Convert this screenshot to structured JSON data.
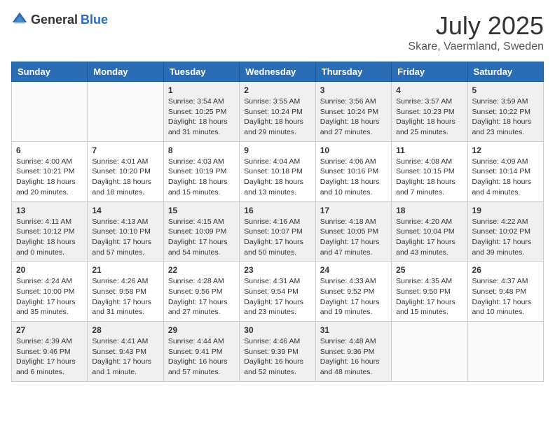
{
  "header": {
    "logo_general": "General",
    "logo_blue": "Blue",
    "month": "July 2025",
    "location": "Skare, Vaermland, Sweden"
  },
  "days_of_week": [
    "Sunday",
    "Monday",
    "Tuesday",
    "Wednesday",
    "Thursday",
    "Friday",
    "Saturday"
  ],
  "weeks": [
    [
      {
        "day": "",
        "empty": true
      },
      {
        "day": "",
        "empty": true
      },
      {
        "day": "1",
        "sunrise": "Sunrise: 3:54 AM",
        "sunset": "Sunset: 10:25 PM",
        "daylight": "Daylight: 18 hours and 31 minutes."
      },
      {
        "day": "2",
        "sunrise": "Sunrise: 3:55 AM",
        "sunset": "Sunset: 10:24 PM",
        "daylight": "Daylight: 18 hours and 29 minutes."
      },
      {
        "day": "3",
        "sunrise": "Sunrise: 3:56 AM",
        "sunset": "Sunset: 10:24 PM",
        "daylight": "Daylight: 18 hours and 27 minutes."
      },
      {
        "day": "4",
        "sunrise": "Sunrise: 3:57 AM",
        "sunset": "Sunset: 10:23 PM",
        "daylight": "Daylight: 18 hours and 25 minutes."
      },
      {
        "day": "5",
        "sunrise": "Sunrise: 3:59 AM",
        "sunset": "Sunset: 10:22 PM",
        "daylight": "Daylight: 18 hours and 23 minutes."
      }
    ],
    [
      {
        "day": "6",
        "sunrise": "Sunrise: 4:00 AM",
        "sunset": "Sunset: 10:21 PM",
        "daylight": "Daylight: 18 hours and 20 minutes."
      },
      {
        "day": "7",
        "sunrise": "Sunrise: 4:01 AM",
        "sunset": "Sunset: 10:20 PM",
        "daylight": "Daylight: 18 hours and 18 minutes."
      },
      {
        "day": "8",
        "sunrise": "Sunrise: 4:03 AM",
        "sunset": "Sunset: 10:19 PM",
        "daylight": "Daylight: 18 hours and 15 minutes."
      },
      {
        "day": "9",
        "sunrise": "Sunrise: 4:04 AM",
        "sunset": "Sunset: 10:18 PM",
        "daylight": "Daylight: 18 hours and 13 minutes."
      },
      {
        "day": "10",
        "sunrise": "Sunrise: 4:06 AM",
        "sunset": "Sunset: 10:16 PM",
        "daylight": "Daylight: 18 hours and 10 minutes."
      },
      {
        "day": "11",
        "sunrise": "Sunrise: 4:08 AM",
        "sunset": "Sunset: 10:15 PM",
        "daylight": "Daylight: 18 hours and 7 minutes."
      },
      {
        "day": "12",
        "sunrise": "Sunrise: 4:09 AM",
        "sunset": "Sunset: 10:14 PM",
        "daylight": "Daylight: 18 hours and 4 minutes."
      }
    ],
    [
      {
        "day": "13",
        "sunrise": "Sunrise: 4:11 AM",
        "sunset": "Sunset: 10:12 PM",
        "daylight": "Daylight: 18 hours and 0 minutes."
      },
      {
        "day": "14",
        "sunrise": "Sunrise: 4:13 AM",
        "sunset": "Sunset: 10:10 PM",
        "daylight": "Daylight: 17 hours and 57 minutes."
      },
      {
        "day": "15",
        "sunrise": "Sunrise: 4:15 AM",
        "sunset": "Sunset: 10:09 PM",
        "daylight": "Daylight: 17 hours and 54 minutes."
      },
      {
        "day": "16",
        "sunrise": "Sunrise: 4:16 AM",
        "sunset": "Sunset: 10:07 PM",
        "daylight": "Daylight: 17 hours and 50 minutes."
      },
      {
        "day": "17",
        "sunrise": "Sunrise: 4:18 AM",
        "sunset": "Sunset: 10:05 PM",
        "daylight": "Daylight: 17 hours and 47 minutes."
      },
      {
        "day": "18",
        "sunrise": "Sunrise: 4:20 AM",
        "sunset": "Sunset: 10:04 PM",
        "daylight": "Daylight: 17 hours and 43 minutes."
      },
      {
        "day": "19",
        "sunrise": "Sunrise: 4:22 AM",
        "sunset": "Sunset: 10:02 PM",
        "daylight": "Daylight: 17 hours and 39 minutes."
      }
    ],
    [
      {
        "day": "20",
        "sunrise": "Sunrise: 4:24 AM",
        "sunset": "Sunset: 10:00 PM",
        "daylight": "Daylight: 17 hours and 35 minutes."
      },
      {
        "day": "21",
        "sunrise": "Sunrise: 4:26 AM",
        "sunset": "Sunset: 9:58 PM",
        "daylight": "Daylight: 17 hours and 31 minutes."
      },
      {
        "day": "22",
        "sunrise": "Sunrise: 4:28 AM",
        "sunset": "Sunset: 9:56 PM",
        "daylight": "Daylight: 17 hours and 27 minutes."
      },
      {
        "day": "23",
        "sunrise": "Sunrise: 4:31 AM",
        "sunset": "Sunset: 9:54 PM",
        "daylight": "Daylight: 17 hours and 23 minutes."
      },
      {
        "day": "24",
        "sunrise": "Sunrise: 4:33 AM",
        "sunset": "Sunset: 9:52 PM",
        "daylight": "Daylight: 17 hours and 19 minutes."
      },
      {
        "day": "25",
        "sunrise": "Sunrise: 4:35 AM",
        "sunset": "Sunset: 9:50 PM",
        "daylight": "Daylight: 17 hours and 15 minutes."
      },
      {
        "day": "26",
        "sunrise": "Sunrise: 4:37 AM",
        "sunset": "Sunset: 9:48 PM",
        "daylight": "Daylight: 17 hours and 10 minutes."
      }
    ],
    [
      {
        "day": "27",
        "sunrise": "Sunrise: 4:39 AM",
        "sunset": "Sunset: 9:46 PM",
        "daylight": "Daylight: 17 hours and 6 minutes."
      },
      {
        "day": "28",
        "sunrise": "Sunrise: 4:41 AM",
        "sunset": "Sunset: 9:43 PM",
        "daylight": "Daylight: 17 hours and 1 minute."
      },
      {
        "day": "29",
        "sunrise": "Sunrise: 4:44 AM",
        "sunset": "Sunset: 9:41 PM",
        "daylight": "Daylight: 16 hours and 57 minutes."
      },
      {
        "day": "30",
        "sunrise": "Sunrise: 4:46 AM",
        "sunset": "Sunset: 9:39 PM",
        "daylight": "Daylight: 16 hours and 52 minutes."
      },
      {
        "day": "31",
        "sunrise": "Sunrise: 4:48 AM",
        "sunset": "Sunset: 9:36 PM",
        "daylight": "Daylight: 16 hours and 48 minutes."
      },
      {
        "day": "",
        "empty": true
      },
      {
        "day": "",
        "empty": true
      }
    ]
  ]
}
